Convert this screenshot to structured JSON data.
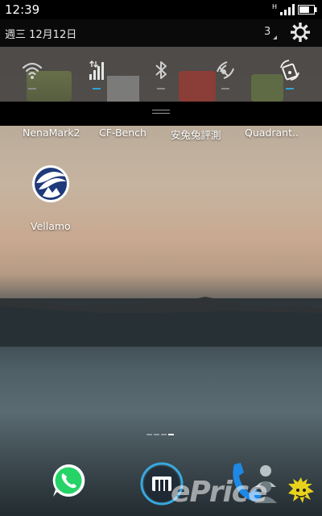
{
  "status_bar": {
    "time": "12:39",
    "network_label": "H",
    "battery_level": 0.7,
    "signal_level": 4
  },
  "notification_header": {
    "date": "週三 12月12日",
    "notification_count": "3",
    "settings_icon": "gear-icon"
  },
  "quick_settings": [
    {
      "icon": "wifi-icon",
      "active": false
    },
    {
      "icon": "mobile-data-icon",
      "active": true
    },
    {
      "icon": "bluetooth-icon",
      "active": false
    },
    {
      "icon": "gps-icon",
      "active": false
    },
    {
      "icon": "auto-rotate-icon",
      "active": true
    }
  ],
  "home_apps": [
    {
      "label": "NenaMark2"
    },
    {
      "label": "CF-Bench"
    },
    {
      "label": "安兔兔評測"
    },
    {
      "label": "Quadrant.."
    }
  ],
  "folder_app": {
    "label": "Vellamo",
    "icon": "vellamo-icon"
  },
  "page_indicator": {
    "pages": 4,
    "current": 4
  },
  "dock": [
    {
      "icon": "whatsapp-icon"
    },
    {
      "icon": "app-drawer-icon"
    },
    {
      "icon": "phone-icon"
    }
  ],
  "watermark": "ePrice",
  "colors": {
    "accent": "#2fa3d8",
    "whatsapp": "#25d366",
    "phone": "#1e88e5"
  }
}
